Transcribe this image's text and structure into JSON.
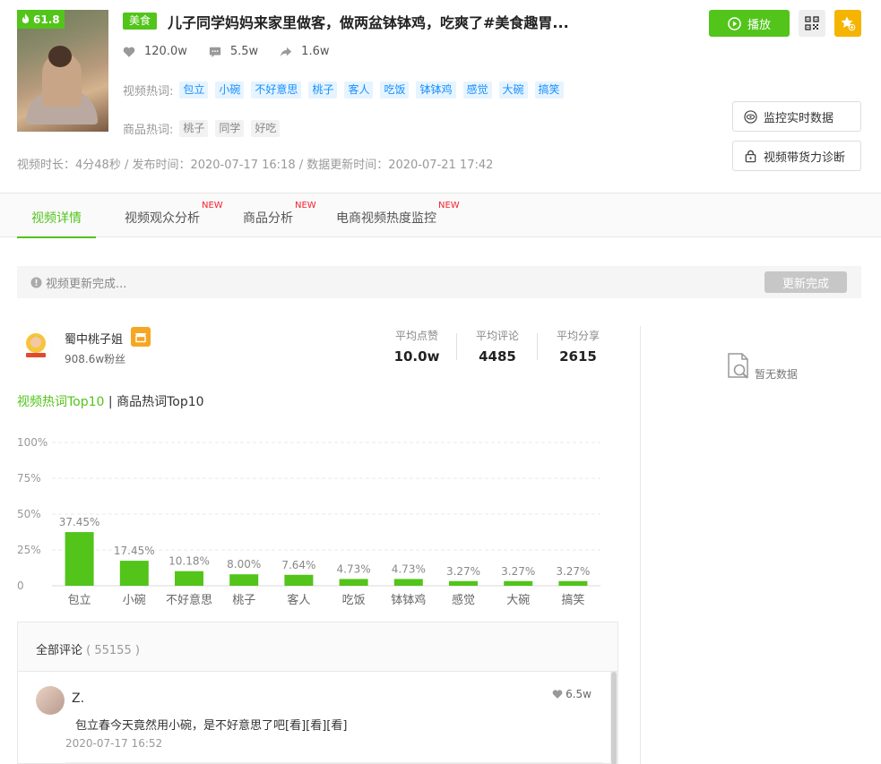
{
  "video": {
    "hot_score": "61.8",
    "category": "美食",
    "title": "儿子同学妈妈来家里做客，做两盆钵钵鸡，吃爽了#美食趣胃...",
    "likes": "120.0w",
    "comments": "5.5w",
    "shares": "1.6w",
    "hot_words_label": "视频热词:",
    "hot_words": [
      "包立",
      "小碗",
      "不好意思",
      "桃子",
      "客人",
      "吃饭",
      "钵钵鸡",
      "感觉",
      "大碗",
      "搞笑"
    ],
    "goods_words_label": "商品热词:",
    "goods_words": [
      "桃子",
      "同学",
      "好吃"
    ],
    "meta": "视频时长：4分48秒 / 发布时间：2020-07-17 16:18 / 数据更新时间：2020-07-21 17:42"
  },
  "actions": {
    "play_label": "播放",
    "monitor_label": "监控实时数据",
    "diagnose_label": "视频带货力诊断"
  },
  "tabs": [
    {
      "label": "视频详情",
      "new": ""
    },
    {
      "label": "视频观众分析",
      "new": "NEW"
    },
    {
      "label": "商品分析",
      "new": "NEW"
    },
    {
      "label": "电商视频热度监控",
      "new": "NEW"
    }
  ],
  "notice": {
    "text": "视频更新完成...",
    "button": "更新完成"
  },
  "author": {
    "name": "蜀中桃子姐",
    "fans": "908.6w粉丝",
    "avg_likes_label": "平均点赞",
    "avg_likes": "10.0w",
    "avg_comments_label": "平均评论",
    "avg_comments": "4485",
    "avg_shares_label": "平均分享",
    "avg_shares": "2615"
  },
  "keyword_switch": {
    "active": "视频热词Top10",
    "separator": "|",
    "inactive": "商品热词Top10"
  },
  "empty": {
    "text": "暂无数据"
  },
  "chart_data": {
    "type": "bar",
    "categories": [
      "包立",
      "小碗",
      "不好意思",
      "桃子",
      "客人",
      "吃饭",
      "钵钵鸡",
      "感觉",
      "大碗",
      "搞笑"
    ],
    "values": [
      37.45,
      17.45,
      10.18,
      8.0,
      7.64,
      4.73,
      4.73,
      3.27,
      3.27,
      3.27
    ],
    "data_labels": [
      "37.45%",
      "17.45%",
      "10.18%",
      "8.00%",
      "7.64%",
      "4.73%",
      "4.73%",
      "3.27%",
      "3.27%",
      "3.27%"
    ],
    "ytick_values": [
      0,
      25,
      50,
      75,
      100
    ],
    "ytick_labels": [
      "0",
      "25%",
      "50%",
      "75%",
      "100%"
    ],
    "ylim": [
      0,
      100
    ],
    "grid": true,
    "bar_color": "#52c41a",
    "title": "",
    "xlabel": "",
    "ylabel": ""
  },
  "comments": {
    "header": "全部评论",
    "count": "( 55155 )",
    "items": [
      {
        "user": "Z.",
        "likes": "6.5w",
        "text": "包立春今天竟然用小碗，是不好意思了吧[看][看][看]",
        "time": "2020-07-17 16:52"
      }
    ]
  },
  "colors": {
    "accent": "#52c41a",
    "gold": "#f5b400",
    "new_badge": "#f5222d",
    "tag_blue": "#1890ff"
  }
}
